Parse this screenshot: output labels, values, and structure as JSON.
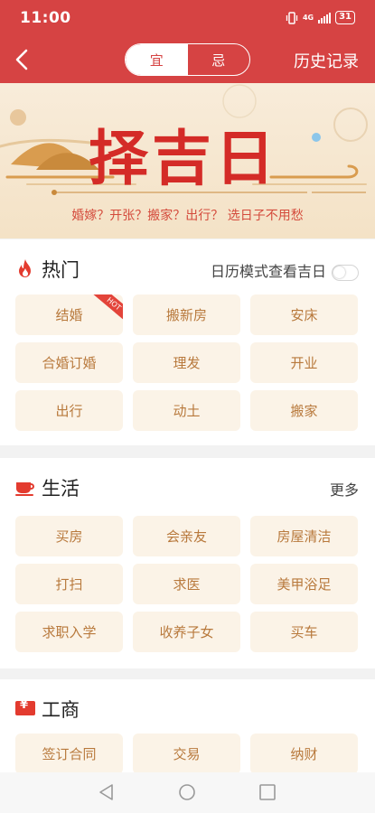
{
  "status": {
    "time": "11:00",
    "network": "4G",
    "battery": "31"
  },
  "nav": {
    "tab_good": "宜",
    "tab_bad": "忌",
    "history": "历史记录"
  },
  "banner": {
    "title": "择吉日",
    "subtitle": "婚嫁？开张？搬家？出行？ 选日子不用愁"
  },
  "hot": {
    "title": "热门",
    "toggle_label": "日历模式查看吉日",
    "ribbon": "HOT",
    "items": [
      "结婚",
      "搬新房",
      "安床",
      "合婚订婚",
      "理发",
      "开业",
      "出行",
      "动土",
      "搬家"
    ]
  },
  "life": {
    "title": "生活",
    "more": "更多",
    "items": [
      "买房",
      "会亲友",
      "房屋清洁",
      "打扫",
      "求医",
      "美甲浴足",
      "求职入学",
      "收养子女",
      "买车"
    ]
  },
  "business": {
    "title": "工商",
    "icon_glyph": "¥",
    "items": [
      "签订合同",
      "交易",
      "纳财"
    ]
  },
  "colors": {
    "brand_red": "#d64343",
    "button_bg": "#fbf3e7",
    "button_text": "#b8793c",
    "banner_red": "#d42b27"
  }
}
